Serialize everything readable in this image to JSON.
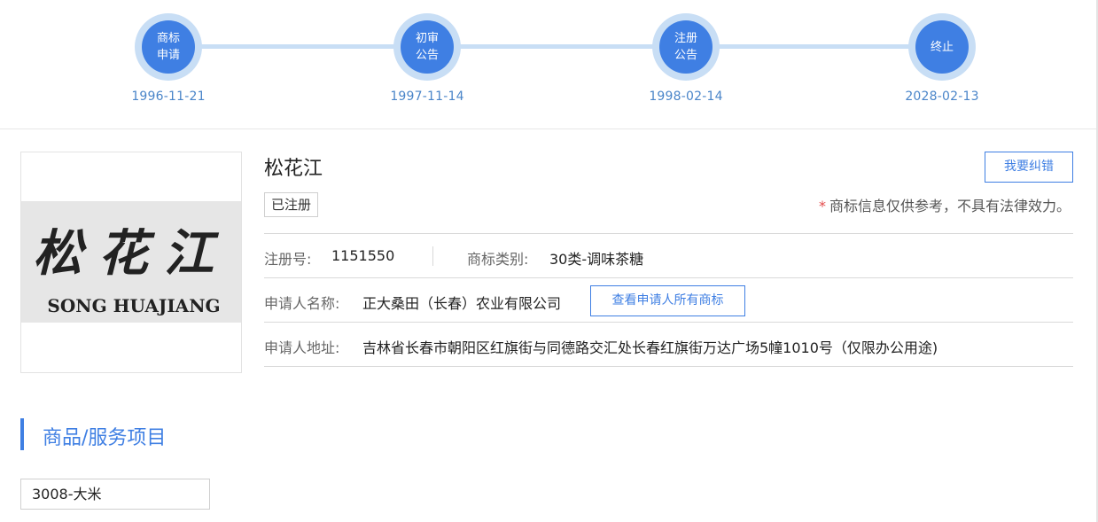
{
  "timeline": {
    "steps": [
      {
        "label": "商标申请",
        "date": "1996-11-21"
      },
      {
        "label": "初审公告",
        "date": "1997-11-14"
      },
      {
        "label": "注册公告",
        "date": "1998-02-14"
      },
      {
        "label": "终止",
        "date": "2028-02-13"
      }
    ]
  },
  "trademark": {
    "name": "松花江",
    "status": "已注册",
    "logo_chinese": "松花江",
    "logo_pinyin": "SONG HUAJIANG",
    "correct_button": "我要纠错",
    "disclaimer": "商标信息仅供参考，不具有法律效力。"
  },
  "details": {
    "reg_no_label": "注册号:",
    "reg_no": "1151550",
    "class_label": "商标类别:",
    "class_value": "30类-调味茶糖",
    "applicant_label": "申请人名称:",
    "applicant": "正大桑田（长春）农业有限公司",
    "view_all_button": "查看申请人所有商标",
    "address_label": "申请人地址:",
    "address": "吉林省长春市朝阳区红旗街与同德路交汇处长春红旗街万达广场5幢1010号（仅限办公用途)"
  },
  "goods_section": {
    "title": "商品/服务项目",
    "items": [
      "3008-大米"
    ]
  },
  "colors": {
    "accent": "#3f7fe3",
    "timeline_halo": "#c8def5",
    "date_text": "#4a85c9",
    "required_star": "#e34a4a"
  }
}
